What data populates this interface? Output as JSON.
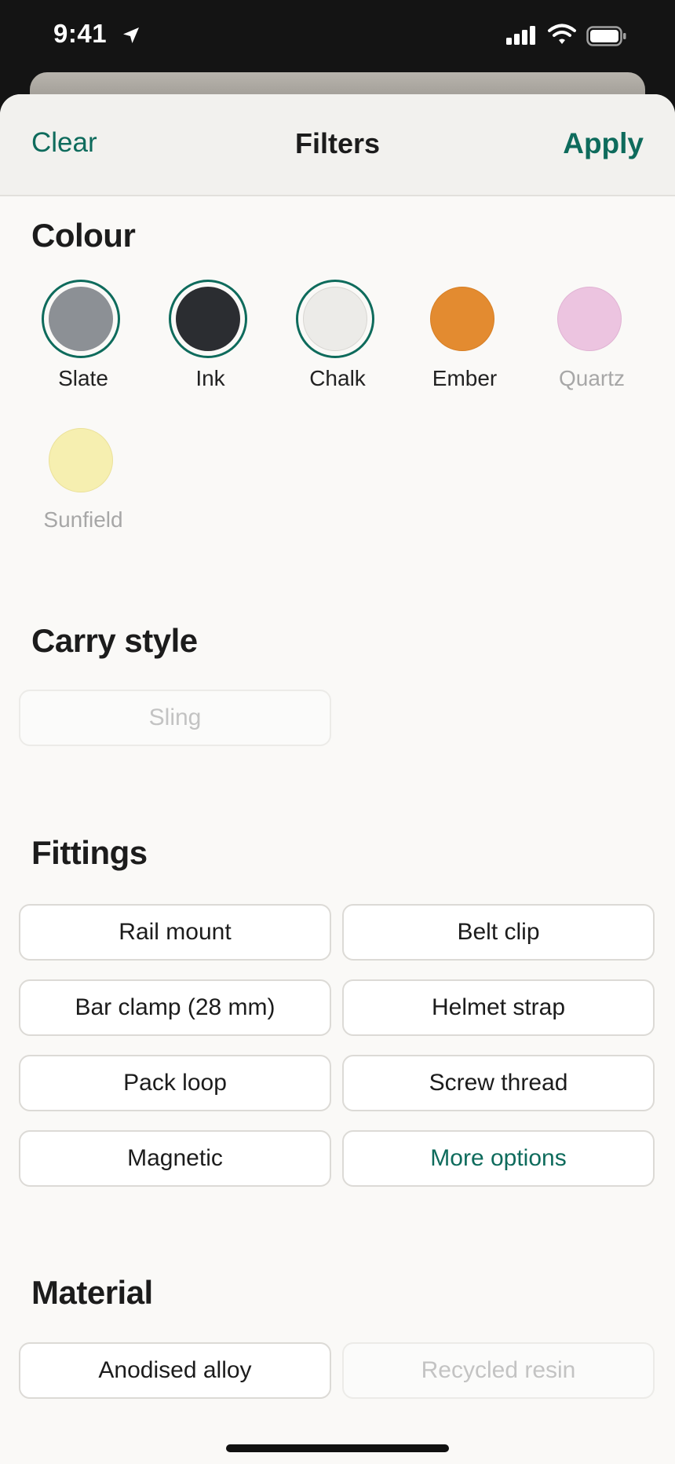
{
  "status_bar": {
    "time": "9:41"
  },
  "header": {
    "clear_label": "Clear",
    "title": "Filters",
    "apply_label": "Apply"
  },
  "colour": {
    "heading": "Colour",
    "swatches": [
      {
        "label": "Slate",
        "color": "#8c9095",
        "selected": true,
        "available": true
      },
      {
        "label": "Ink",
        "color": "#2b2d31",
        "selected": true,
        "available": true
      },
      {
        "label": "Chalk",
        "color": "#ecebe8",
        "selected": true,
        "available": true
      },
      {
        "label": "Ember",
        "color": "#e38b30",
        "selected": false,
        "available": true
      },
      {
        "label": "Quartz",
        "color": "#ecc4e0",
        "selected": false,
        "available": false
      },
      {
        "label": "Sunfield",
        "color": "#f6efb0",
        "selected": false,
        "available": false
      }
    ]
  },
  "carry_style": {
    "heading": "Carry style",
    "options": [
      {
        "label": "Sling",
        "disabled": true
      }
    ]
  },
  "fittings": {
    "heading": "Fittings",
    "options": [
      {
        "label": "Rail mount"
      },
      {
        "label": "Belt clip"
      },
      {
        "label": "Bar clamp (28 mm)"
      },
      {
        "label": "Helmet strap"
      },
      {
        "label": "Pack loop"
      },
      {
        "label": "Screw thread"
      },
      {
        "label": "Magnetic"
      },
      {
        "label": "More options"
      }
    ]
  },
  "material": {
    "heading": "Material",
    "options": [
      {
        "label": "Anodised alloy",
        "disabled": false
      },
      {
        "label": "Recycled resin",
        "disabled": true
      }
    ]
  },
  "colors": {
    "accent": "#0e6b5c",
    "sheet_background": "#faf9f7",
    "header_background": "#f2f1ee"
  }
}
